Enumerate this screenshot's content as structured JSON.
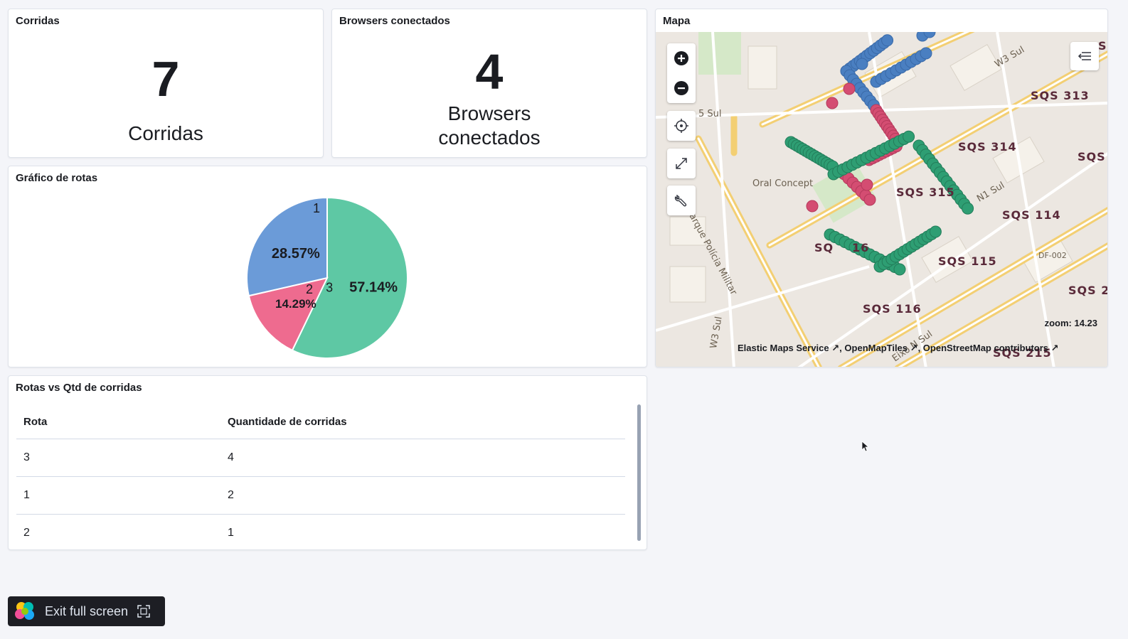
{
  "panels": {
    "corridas": {
      "title": "Corridas",
      "value": "7",
      "label": "Corridas"
    },
    "browsers": {
      "title": "Browsers conectados",
      "value": "4",
      "label_line1": "Browsers",
      "label_line2": "conectados"
    },
    "pie": {
      "title": "Gráfico de rotas"
    },
    "map": {
      "title": "Mapa",
      "zoom_text": "zoom: 14.23",
      "attribution": [
        "Elastic Maps Service",
        "OpenMapTiles",
        "OpenStreetMap contributors"
      ],
      "labels": [
        "SQS 313",
        "SQS 314",
        "SQS",
        "SQS 315",
        "SQS 114",
        "SQS 115",
        "SQS 116",
        "SQS 2",
        "SQS 215",
        "SQ",
        "16",
        "Sc"
      ],
      "road_labels": [
        "W3 Sul",
        "5 Sul",
        "N1 Sul",
        "Oral Concept",
        "Via Parque Polícia Militar",
        "DF-002",
        "W3 Sul",
        "Eixo N Sul"
      ]
    },
    "table": {
      "title": "Rotas vs Qtd de corridas",
      "columns": [
        "Rota",
        "Quantidade de corridas"
      ],
      "rows": [
        [
          "3",
          "4"
        ],
        [
          "1",
          "2"
        ],
        [
          "2",
          "1"
        ]
      ]
    }
  },
  "chart_data": {
    "type": "pie",
    "slices": [
      {
        "label": "3",
        "value": 57.14,
        "value_label": "57.14%",
        "color": "#5ec8a4"
      },
      {
        "label": "2",
        "value": 14.29,
        "value_label": "14.29%",
        "color": "#ee6b8f"
      },
      {
        "label": "1",
        "value": 28.57,
        "value_label": "28.57%",
        "color": "#6b9bd8"
      }
    ]
  },
  "exit_fullscreen": {
    "label": "Exit full screen"
  },
  "colors": {
    "route1": "#4a7fc1",
    "route2": "#d44d72",
    "route3": "#2e9e73",
    "background": "#f4f5f9"
  }
}
